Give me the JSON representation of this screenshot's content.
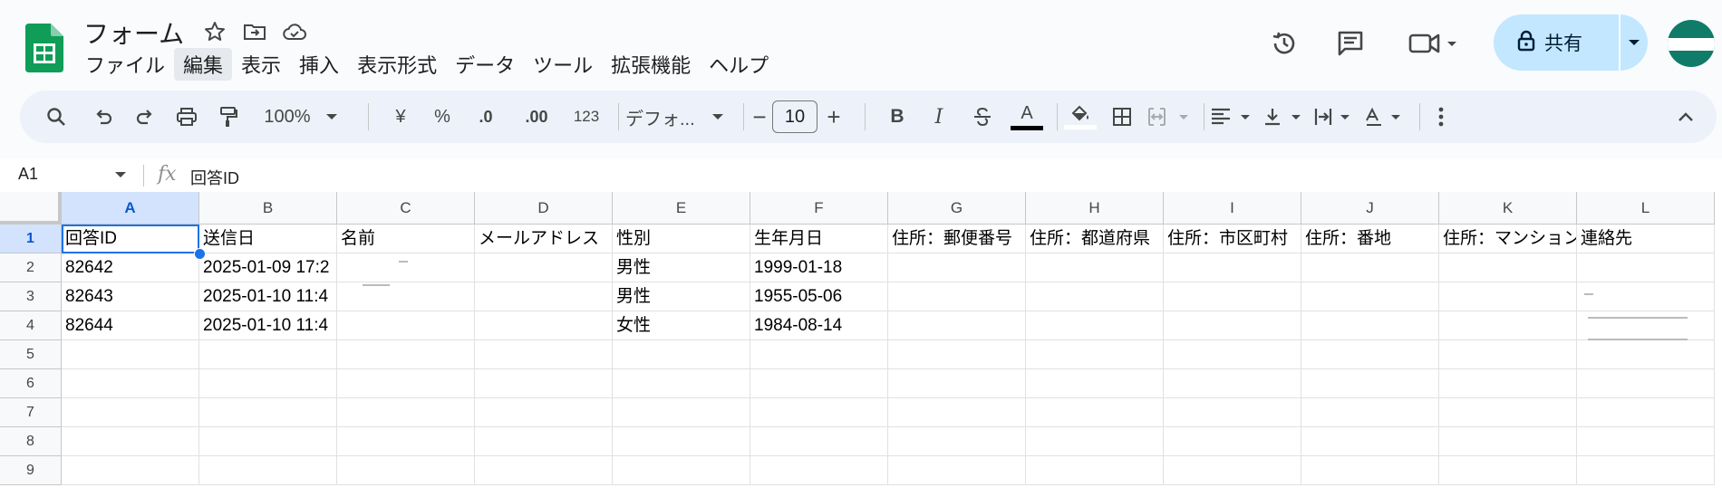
{
  "app": {
    "doc_title": "フォーム",
    "menu": [
      "ファイル",
      "編集",
      "表示",
      "挿入",
      "表示形式",
      "データ",
      "ツール",
      "拡張機能",
      "ヘルプ"
    ],
    "active_menu_index": 1,
    "share_label": "共有",
    "accent_color": "#0b57d0",
    "share_bg": "#c2e7ff"
  },
  "toolbar": {
    "zoom": "100%",
    "currency": "¥",
    "percent": "%",
    "decrease_decimal": ".0",
    "increase_decimal": ".00",
    "number_format": "123",
    "font": "デフォ...",
    "font_size": "10",
    "bold": "B",
    "italic": "I",
    "text_color_letter": "A"
  },
  "formula_bar": {
    "name_box": "A1",
    "fx": "fx",
    "value": "回答ID"
  },
  "sheet": {
    "columns": [
      "A",
      "B",
      "C",
      "D",
      "E",
      "F",
      "G",
      "H",
      "I",
      "J",
      "K",
      "L"
    ],
    "selected_column": "A",
    "selected_row": "1",
    "row_numbers": [
      "1",
      "2",
      "3",
      "4",
      "5",
      "6",
      "7",
      "8",
      "9"
    ],
    "headers": [
      "回答ID",
      "送信日",
      "名前",
      "メールアドレス",
      "性別",
      "生年月日",
      "住所：郵便番号",
      "住所：都道府県",
      "住所：市区町村",
      "住所：番地",
      "住所：マンション",
      "連絡先"
    ],
    "rows": [
      [
        "82642",
        "2025-01-09 17:2",
        "",
        "",
        "男性",
        "1999-01-18",
        "",
        "",
        "",
        "",
        "",
        ""
      ],
      [
        "82643",
        "2025-01-10 11:4",
        "",
        "",
        "男性",
        "1955-05-06",
        "",
        "",
        "",
        "",
        "",
        ""
      ],
      [
        "82644",
        "2025-01-10 11:4",
        "",
        "",
        "女性",
        "1984-08-14",
        "",
        "",
        "",
        "",
        "",
        ""
      ]
    ]
  }
}
